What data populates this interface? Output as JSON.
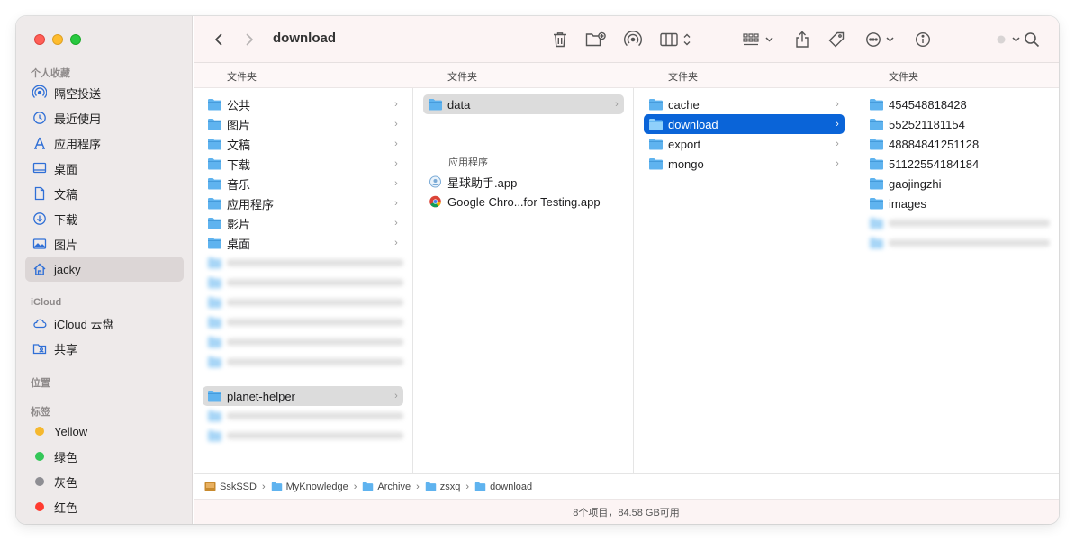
{
  "sidebar": {
    "sections": {
      "favorites": "个人收藏",
      "icloud": "iCloud",
      "locations": "位置",
      "tags": "标签"
    },
    "favorites": [
      {
        "label": "隔空投送",
        "icon": "airdrop-icon"
      },
      {
        "label": "最近使用",
        "icon": "clock-icon"
      },
      {
        "label": "应用程序",
        "icon": "applications-icon"
      },
      {
        "label": "桌面",
        "icon": "desktop-icon"
      },
      {
        "label": "文稿",
        "icon": "document-icon"
      },
      {
        "label": "下载",
        "icon": "download-icon"
      },
      {
        "label": "图片",
        "icon": "photo-icon"
      },
      {
        "label": "jacky",
        "icon": "home-icon"
      }
    ],
    "icloud": [
      {
        "label": "iCloud 云盘",
        "icon": "cloud-icon"
      },
      {
        "label": "共享",
        "icon": "shared-folder-icon"
      }
    ],
    "tags": [
      {
        "label": "Yellow",
        "color": "#f5b82e"
      },
      {
        "label": "绿色",
        "color": "#34c759"
      },
      {
        "label": "灰色",
        "color": "#8e8e93"
      },
      {
        "label": "红色",
        "color": "#ff3b30"
      }
    ]
  },
  "toolbar": {
    "title": "download"
  },
  "columns": {
    "header": "文件夹",
    "col1": {
      "items": [
        "公共",
        "图片",
        "文稿",
        "下载",
        "音乐",
        "应用程序",
        "影片",
        "桌面"
      ],
      "selected": "planet-helper",
      "doc_label": "文稿"
    },
    "col2": {
      "folder": "data",
      "apps_label": "应用程序",
      "apps": [
        "星球助手.app",
        "Google Chro...for Testing.app"
      ]
    },
    "col3": {
      "items": [
        "cache",
        "download",
        "export",
        "mongo"
      ]
    },
    "col4": {
      "items": [
        "454548818428",
        "552521181154",
        "48884841251128",
        "51122554184184",
        "gaojingzhi",
        "images"
      ]
    }
  },
  "pathbar": [
    "SskSSD",
    "MyKnowledge",
    "Archive",
    "zsxq",
    "download"
  ],
  "status": "8个项目，84.58 GB可用",
  "colors": {
    "accent": "#0a64d8",
    "folder": "#5fb3ef"
  }
}
